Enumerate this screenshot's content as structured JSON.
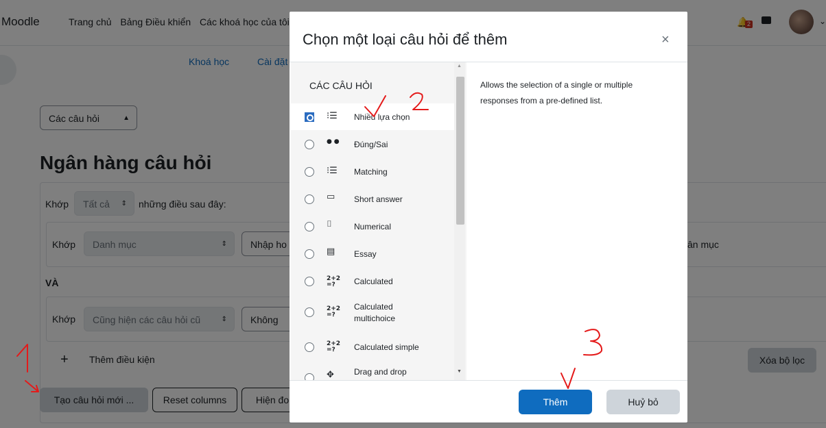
{
  "topnav": {
    "brand": "Moodle",
    "links": [
      "Trang chủ",
      "Bảng Điều khiển",
      "Các khoá học của tôi"
    ],
    "notification_count": "2"
  },
  "subnav": {
    "items": [
      "Khoá học",
      "Cài đặt"
    ]
  },
  "page": {
    "bank_select": "Các câu hỏi",
    "title": "Ngân hàng câu hỏi",
    "match_label": "Khớp",
    "match_select": "Tất cả",
    "match_suffix": "những điều sau đây:",
    "cond1": {
      "label": "Khớp",
      "select": "Danh mục",
      "input": "Nhập ho",
      "right_text": "ân mục"
    },
    "and_label": "VÀ",
    "cond2": {
      "label": "Khớp",
      "select": "Cũng hiện các câu hỏi cũ",
      "input": "Không"
    },
    "add_condition": "Thêm điều kiện",
    "clear_filter": "Xóa bộ lọc",
    "new_question": "Tạo câu hỏi mới ...",
    "reset_columns": "Reset columns",
    "show_more": "Hiện đo"
  },
  "modal": {
    "title": "Chọn một loại câu hỏi để thêm",
    "close": "×",
    "section": "CÁC CÂU HỎI",
    "items": [
      {
        "icon": "multichoice-icon",
        "glyph": "⁝☰",
        "label": "Nhiều lựa chọn",
        "selected": true
      },
      {
        "icon": "truefalse-icon",
        "glyph": "● ●",
        "label": "Đúng/Sai"
      },
      {
        "icon": "matching-icon",
        "glyph": "⁝☰",
        "label": "Matching"
      },
      {
        "icon": "shortanswer-icon",
        "glyph": "▭",
        "label": "Short answer"
      },
      {
        "icon": "numerical-icon",
        "glyph": "⌷",
        "label": "Numerical"
      },
      {
        "icon": "essay-icon",
        "glyph": "▤",
        "label": "Essay"
      },
      {
        "icon": "calculated-icon",
        "glyph": "2+2",
        "label": "Calculated"
      },
      {
        "icon": "calculatedmulti-icon",
        "glyph": "2+2",
        "label": "Calculated multichoice"
      },
      {
        "icon": "calculatedsimple-icon",
        "glyph": "2+2",
        "label": "Calculated simple"
      },
      {
        "icon": "draganddrop-icon",
        "glyph": "✥",
        "label": "Drag and drop"
      }
    ],
    "description": "Allows the selection of a single or multiple responses from a pre-defined list.",
    "add_button": "Thêm",
    "cancel_button": "Huỷ bỏ"
  },
  "annotations": [
    "1",
    "2",
    "3"
  ],
  "colors": {
    "primary": "#0f6cbf",
    "annotation": "#e41a1a",
    "overlay": "rgba(0,0,0,0.5)"
  }
}
